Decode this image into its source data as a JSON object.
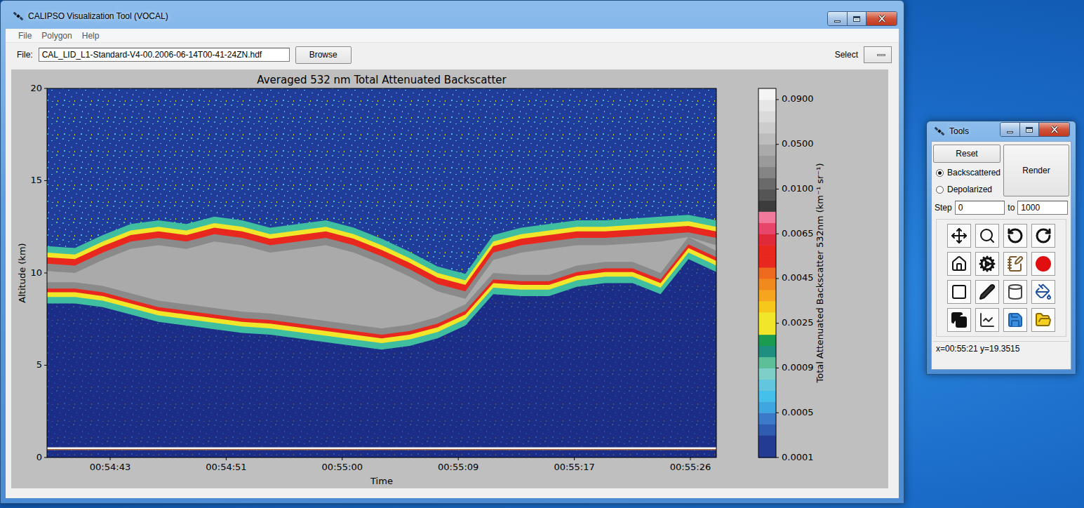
{
  "window": {
    "title": "CALIPSO Visualization Tool (VOCAL)"
  },
  "menu": [
    "File",
    "Polygon",
    "Help"
  ],
  "file_row": {
    "label": "File:",
    "value": "CAL_LID_L1-Standard-V4-00.2006-06-14T00-41-24ZN.hdf",
    "browse": "Browse",
    "select_label": "Select"
  },
  "chart": {
    "title": "Averaged 532 nm Total Attenuated Backscatter",
    "y_label": "Altitude (km)",
    "y_max": 20,
    "y_ticks": [
      "0",
      "5",
      "10",
      "15",
      "20"
    ],
    "x_label": "Time",
    "x_ticks": [
      "00:54:43",
      "00:54:51",
      "00:55:00",
      "00:55:09",
      "00:55:17",
      "00:55:26"
    ],
    "cloud_top_km": [
      11.1,
      11.0,
      11.7,
      12.3,
      12.5,
      12.3,
      12.7,
      12.5,
      12.1,
      12.3,
      12.5,
      12.1,
      11.5,
      10.8,
      10.0,
      9.6,
      11.7,
      12.1,
      12.3,
      12.5,
      12.5,
      12.6,
      12.7,
      12.8,
      12.5
    ],
    "cloud_base_km": [
      8.7,
      8.7,
      8.5,
      8.1,
      7.7,
      7.5,
      7.3,
      7.1,
      7.0,
      6.8,
      6.6,
      6.4,
      6.2,
      6.4,
      6.8,
      7.5,
      9.2,
      9.1,
      9.1,
      9.6,
      9.8,
      9.8,
      9.2,
      11.1,
      10.4
    ],
    "surface_km": 0.5,
    "colorbar": {
      "label": "Total Attenuated Backscatter 532nm (km⁻¹ sr⁻¹)",
      "ticks": [
        "0.0001",
        "0.0005",
        "0.0009",
        "0.0025",
        "0.0045",
        "0.0065",
        "0.0100",
        "0.0500",
        "0.0900"
      ],
      "colors": [
        "#233b93",
        "#233b93",
        "#2f5cb0",
        "#3a7ac8",
        "#3fa6e0",
        "#45c0ea",
        "#62c7de",
        "#7ecfc8",
        "#5cbf9a",
        "#1f8f80",
        "#1a9b50",
        "#f2e62a",
        "#f2e62a",
        "#f7c81c",
        "#f5a51e",
        "#f08a1e",
        "#ee6a1e",
        "#e8281e",
        "#e8281e",
        "#e02a3a",
        "#e8456a",
        "#f07a9c",
        "#3c3c3c",
        "#555555",
        "#6a6a6a",
        "#858585",
        "#9a9a9a",
        "#aaaaaa",
        "#bdbdbd",
        "#cccccc",
        "#dadada",
        "#e6e6e6",
        "#f5f5f5"
      ]
    }
  },
  "tools": {
    "title": "Tools",
    "reset": "Reset",
    "render": "Render",
    "modes": [
      {
        "label": "Backscattered",
        "selected": true
      },
      {
        "label": "Depolarized",
        "selected": false
      }
    ],
    "step_label": "Step",
    "step_from": "0",
    "to_label": "to",
    "step_to": "1000",
    "status": "x=00:55:21 y=19.3515"
  }
}
